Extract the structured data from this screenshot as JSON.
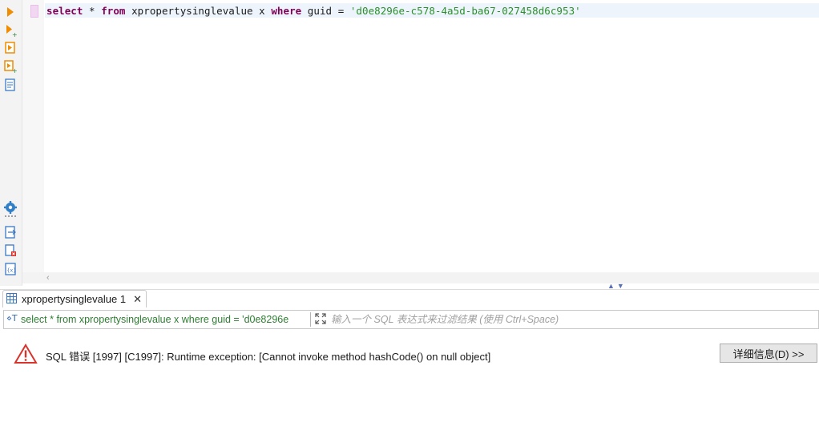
{
  "editor": {
    "sql_line": {
      "kw_select": "select",
      "star": " * ",
      "kw_from": "from",
      "table": " xpropertysinglevalue x ",
      "kw_where": "where",
      "cond": " guid = ",
      "literal": "'d0e8296e-c578-4a5d-ba67-027458d6c953'"
    },
    "toolbar_icons": [
      "execute-statement-icon",
      "execute-in-new-tab-icon",
      "execute-script-icon",
      "execute-script-new-tabs-icon",
      "explain-plan-icon",
      "settings-icon",
      "export-icon",
      "close-results-icon",
      "show-variables-icon"
    ]
  },
  "results": {
    "tab_label": "xpropertysinglevalue 1",
    "query_text": "select * from xpropertysinglevalue x where guid = 'd0e8296e",
    "filter_placeholder": "输入一个 SQL 表达式来过滤结果 (使用 Ctrl+Space)",
    "error_message": "SQL 错误 [1997] [C1997]: Runtime exception: [Cannot invoke method hashCode() on null object]",
    "details_button_label": "详细信息(D) >>"
  },
  "colors": {
    "keyword": "#7f0055",
    "string_literal": "#2a8f2a",
    "query_text": "#2e7d32",
    "current_line": "#eef4fc",
    "warning_red": "#d9342b"
  }
}
